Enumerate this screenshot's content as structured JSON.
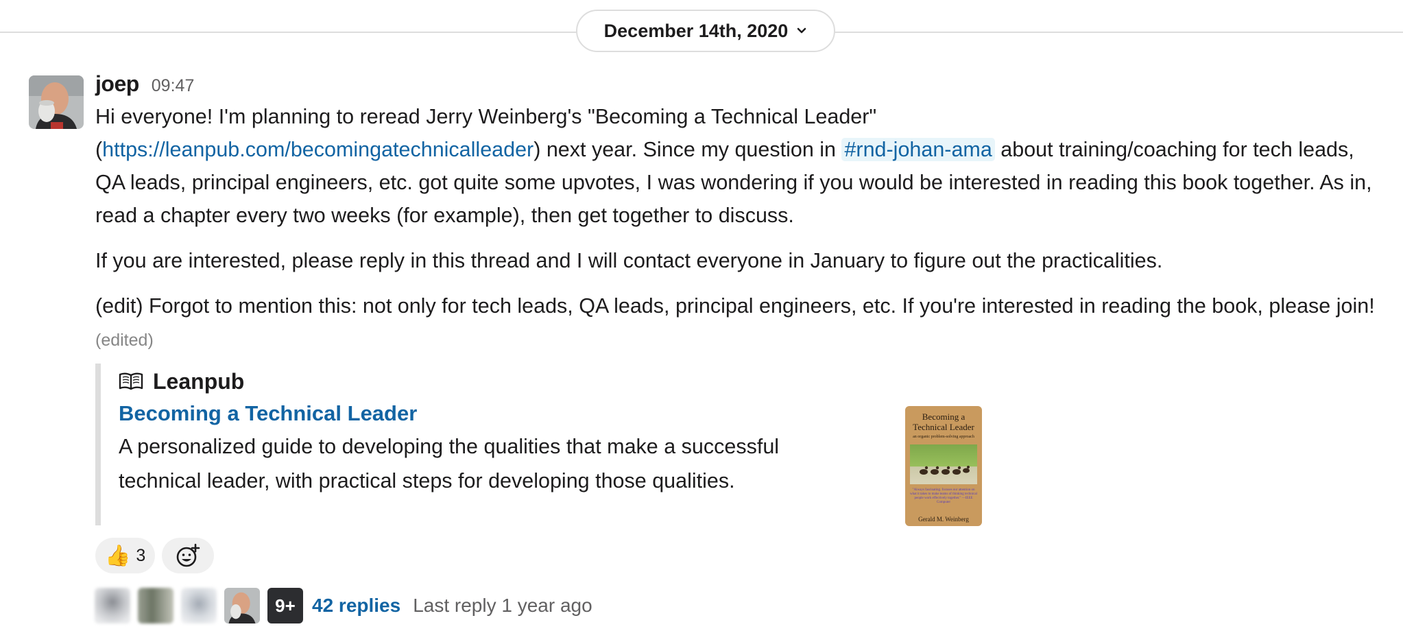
{
  "date_divider": {
    "label": "December 14th, 2020"
  },
  "message": {
    "author": "joep",
    "time": "09:47",
    "p1_a": "Hi everyone! I'm planning to reread Jerry Weinberg's \"Becoming a Technical Leader\"",
    "p1_paren_open": "(",
    "p1_link": "https://leanpub.com/becomingatechnicalleader",
    "p1_b": ") next year. Since my question in ",
    "p1_channel": "#rnd-johan-ama",
    "p1_c": " about training/coaching for tech leads, QA leads, principal engineers, etc. got quite some upvotes, I was wondering if you would be interested in reading this book together. As in, read a chapter every two weeks (for example), then get together to discuss.",
    "p2": "If you are interested, please reply in this thread and I will contact everyone in January to figure out the practicalities.",
    "p3": "(edit) Forgot to mention this: not only for tech leads, QA leads, principal engineers, etc.  If you're interested in reading the book, please join!",
    "edited": "(edited)"
  },
  "attachment": {
    "site": "Leanpub",
    "title": "Becoming a Technical Leader",
    "description": "A personalized guide to developing the qualities that make a successful technical leader, with practical steps for developing those qualities.",
    "book_cover": {
      "title": "Becoming a Technical Leader",
      "subtitle": "an organic problem-solving approach",
      "quote": "\"Always fascinating. focuses our attention on what it takes to make teams of thinking technical people work effectively together.\" —IEEE Computer",
      "author": "Gerald M. Weinberg"
    }
  },
  "reactions": [
    {
      "emoji": "👍",
      "count": "3"
    }
  ],
  "thread": {
    "more_label": "9+",
    "replies": "42 replies",
    "last_reply": "Last reply 1 year ago"
  },
  "colors": {
    "link": "#1264a3",
    "channel_bg": "#e8f5fa",
    "border": "#dddddd",
    "muted": "#616061"
  },
  "icons": [
    "chevron-down-icon",
    "book-icon",
    "add-reaction-icon"
  ]
}
